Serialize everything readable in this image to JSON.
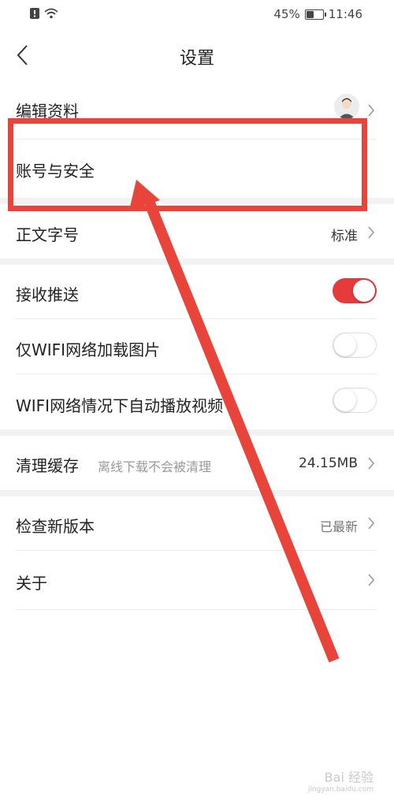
{
  "status_bar": {
    "battery_percent": "45%",
    "battery_level": 0.45,
    "time": "11:46"
  },
  "header": {
    "title": "设置"
  },
  "settings": {
    "edit_profile": {
      "label": "编辑资料"
    },
    "account_security": {
      "label": "账号与安全"
    },
    "font_size": {
      "label": "正文字号",
      "value": "标准"
    },
    "receive_push": {
      "label": "接收推送",
      "enabled": true
    },
    "wifi_images": {
      "label": "仅WIFI网络加载图片",
      "enabled": false
    },
    "wifi_autoplay": {
      "label": "WIFI网络情况下自动播放视频",
      "enabled": false
    },
    "clear_cache": {
      "label": "清理缓存",
      "hint": "离线下载不会被清理",
      "value": "24.15MB"
    },
    "check_update": {
      "label": "检查新版本",
      "value": "已最新"
    },
    "about": {
      "label": "关于"
    }
  },
  "annotation_color": "#e8443a",
  "accent_color": "#e63b3b",
  "watermark": {
    "text": "Bai 经验",
    "sub": "jingyan.baidu.com"
  }
}
